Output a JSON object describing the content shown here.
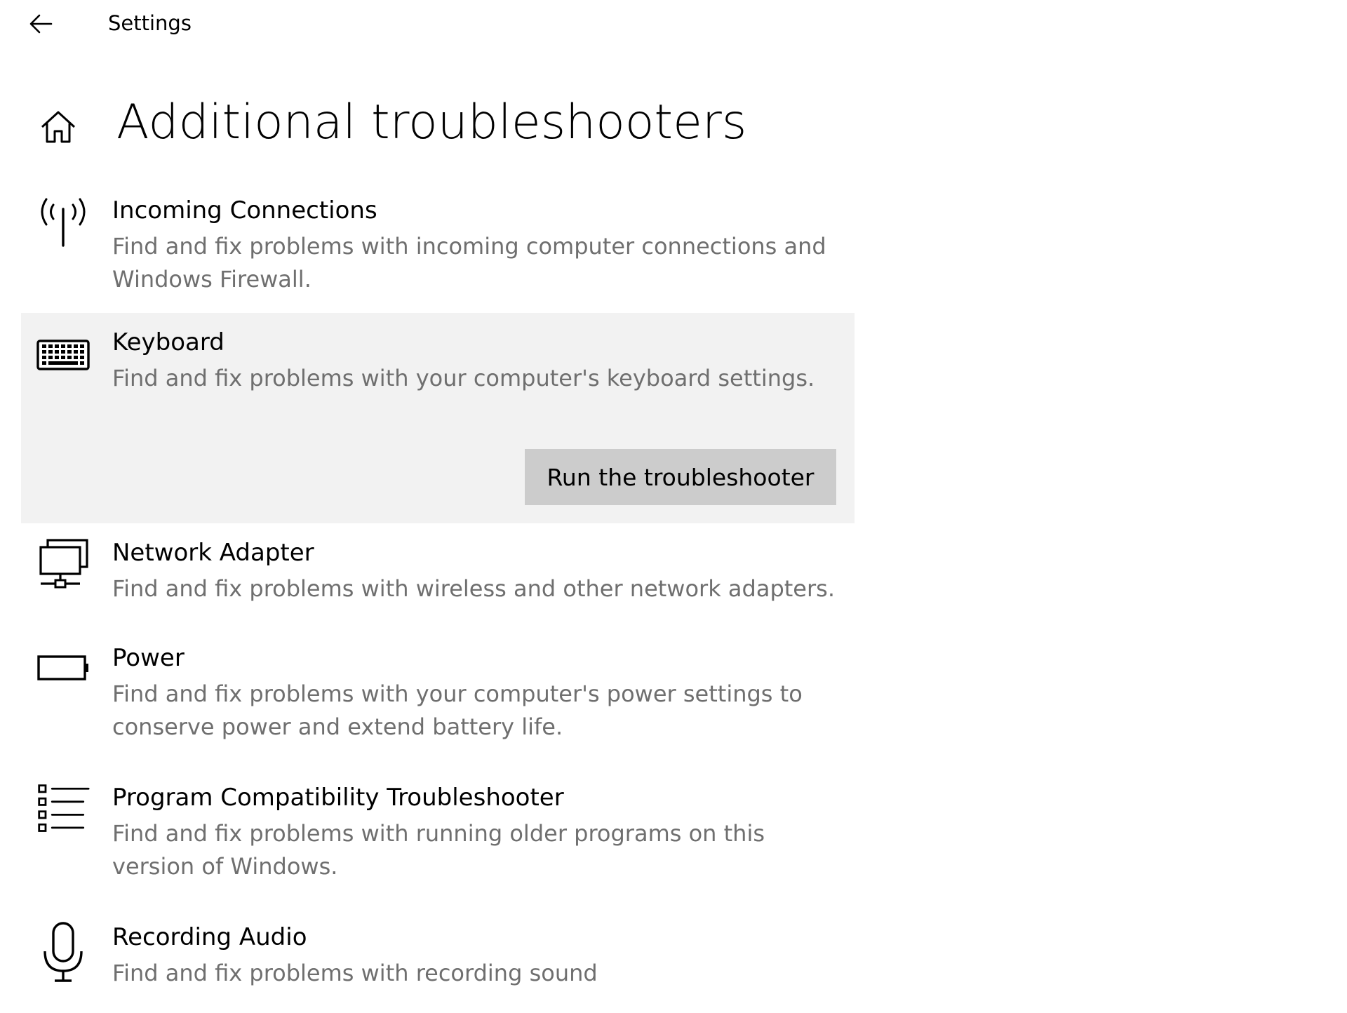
{
  "titlebar": {
    "back_icon": "arrow-left-icon",
    "app_title": "Settings"
  },
  "header": {
    "home_icon": "home-icon",
    "title": "Additional troubleshooters"
  },
  "troubleshooters": [
    {
      "icon": "antenna-icon",
      "name": "Incoming Connections",
      "description": "Find and fix problems with incoming computer connections and Windows Firewall."
    },
    {
      "icon": "keyboard-icon",
      "name": "Keyboard",
      "description": "Find and fix problems with your computer's keyboard settings.",
      "selected": true,
      "action_label": "Run the troubleshooter"
    },
    {
      "icon": "network-adapter-icon",
      "name": "Network Adapter",
      "description": "Find and fix problems with wireless and other network adapters."
    },
    {
      "icon": "battery-icon",
      "name": "Power",
      "description": "Find and fix problems with your computer's power settings to conserve power and extend battery life."
    },
    {
      "icon": "checklist-icon",
      "name": "Program Compatibility Troubleshooter",
      "description": "Find and fix problems with running older programs on this version of Windows."
    },
    {
      "icon": "microphone-icon",
      "name": "Recording Audio",
      "description": "Find and fix problems with recording sound"
    }
  ],
  "colors": {
    "selected_background": "#f2f2f2",
    "button_background": "#cccccc",
    "description_text": "#6f6f6f"
  }
}
